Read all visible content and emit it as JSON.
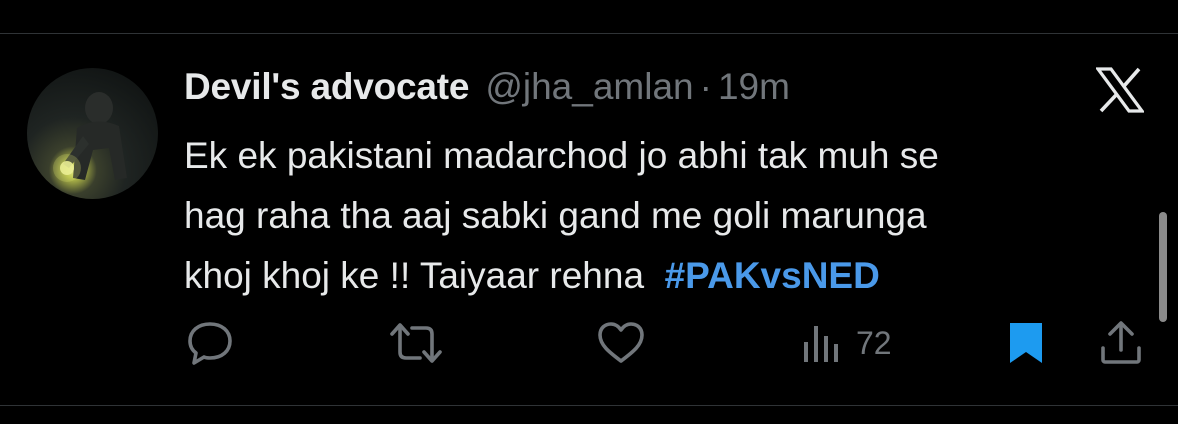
{
  "tweet": {
    "display_name": "Devil's advocate",
    "handle": "@jha_amlan",
    "separator": "·",
    "time": "19m",
    "text": "Ek ek pakistani madarchod jo abhi tak muh se\nhag raha tha aaj sabki gand me goli marunga\nkhoj khoj ke !! Taiyaar rehna  ",
    "hashtag": "#PAKvsNED"
  },
  "actions": {
    "reply_icon": "reply-icon",
    "retweet_icon": "retweet-icon",
    "like_icon": "heart-icon",
    "views_icon": "views-chart-icon",
    "views_count": "72",
    "bookmark_icon": "bookmark-filled-icon",
    "share_icon": "share-icon"
  },
  "colors": {
    "background": "#000000",
    "text_primary": "#e7e9ea",
    "text_secondary": "#71767b",
    "accent": "#4a99e9",
    "bookmark": "#1d9bf0"
  }
}
